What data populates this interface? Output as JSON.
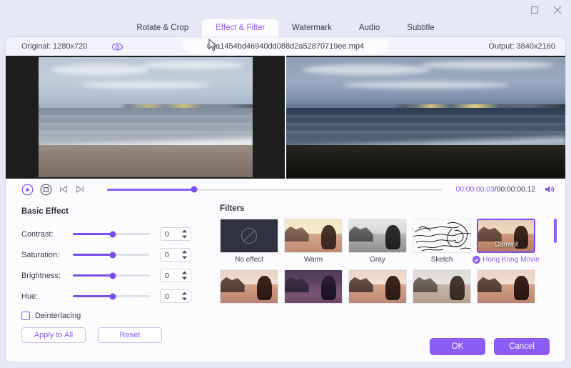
{
  "window": {
    "maximize_icon": "maximize-icon",
    "close_icon": "close-icon"
  },
  "tabs": [
    {
      "label": "Rotate & Crop",
      "active": false
    },
    {
      "label": "Effect & Filter",
      "active": true
    },
    {
      "label": "Watermark",
      "active": false
    },
    {
      "label": "Audio",
      "active": false
    },
    {
      "label": "Subtitle",
      "active": false
    }
  ],
  "info_strip": {
    "original_label": "Original: 1280x720",
    "eye_icon": "eye-icon",
    "filename": "0da1454bd46940dd088d2a52870719ee.mp4",
    "output_label": "Output: 3840x2160"
  },
  "transport": {
    "play_icon": "play-circle-icon",
    "stop_icon": "stop-circle-icon",
    "prev_frame_icon": "previous-frame-icon",
    "next_frame_icon": "next-frame-icon",
    "volume_icon": "volume-icon",
    "current_time": "00:00:00.03",
    "time_separator": "/",
    "total_time": "00:00:00.12",
    "seek_percent": 26
  },
  "basic_effect": {
    "title": "Basic Effect",
    "sliders": [
      {
        "label": "Contrast:",
        "value": "0",
        "percent": 52
      },
      {
        "label": "Saturation:",
        "value": "0",
        "percent": 52
      },
      {
        "label": "Brightness:",
        "value": "0",
        "percent": 52
      },
      {
        "label": "Hue:",
        "value": "0",
        "percent": 52
      }
    ],
    "deinterlacing_label": "Deinterlacing",
    "deinterlacing_checked": false,
    "apply_to_all_label": "Apply to All",
    "reset_label": "Reset"
  },
  "filters": {
    "title": "Filters",
    "current_badge": "Current",
    "items": [
      {
        "name": "No effect",
        "selected": false,
        "style": "noeffect"
      },
      {
        "name": "Warm",
        "selected": false,
        "style": "warm"
      },
      {
        "name": "Gray",
        "selected": false,
        "style": "gray"
      },
      {
        "name": "Sketch",
        "selected": false,
        "style": "sketch"
      },
      {
        "name": "Hong Kong Movie",
        "selected": true,
        "style": "hongkong"
      },
      {
        "name": "",
        "selected": false,
        "style": "plain"
      },
      {
        "name": "",
        "selected": false,
        "style": "purple"
      },
      {
        "name": "",
        "selected": false,
        "style": "plain"
      },
      {
        "name": "",
        "selected": false,
        "style": "faded"
      },
      {
        "name": "",
        "selected": false,
        "style": "plain"
      }
    ]
  },
  "footer": {
    "ok_label": "OK",
    "cancel_label": "Cancel"
  },
  "colors": {
    "accent": "#8b5cf6",
    "accent_strong": "#7c4dee",
    "window_bg": "#e7e8f5",
    "panel_bg": "#fcfcff"
  }
}
